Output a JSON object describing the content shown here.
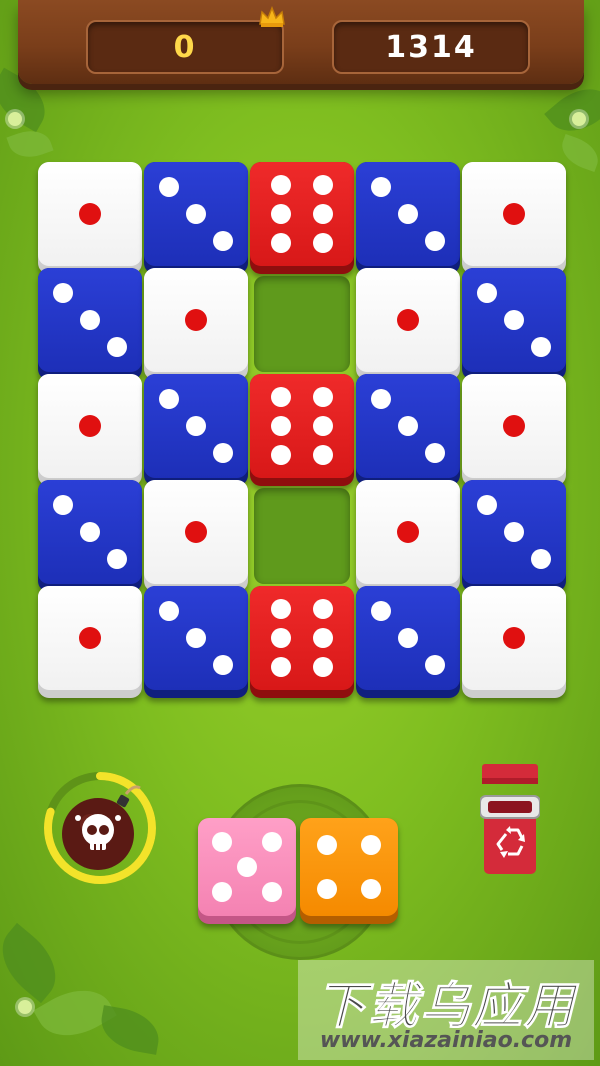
{
  "scores": {
    "current": "0",
    "best": "1314"
  },
  "icons": {
    "crown": "crown-icon",
    "bomb": "bomb-skull-icon",
    "trash": "recycle-trash-icon"
  },
  "colors": {
    "white_die": "#ffffff",
    "blue_die": "#2536cc",
    "red_die": "#e52020",
    "pink_die": "#f78fb9",
    "orange_die": "#f7900a",
    "background": "#86c224"
  },
  "board": {
    "rows": 5,
    "cols": 5,
    "cells": [
      [
        "white-1",
        "blue-3",
        "red-6",
        "blue-3",
        "white-1"
      ],
      [
        "blue-3",
        "white-1",
        "empty",
        "white-1",
        "blue-3"
      ],
      [
        "white-1",
        "blue-3",
        "red-6",
        "blue-3",
        "white-1"
      ],
      [
        "blue-3",
        "white-1",
        "empty",
        "white-1",
        "blue-3"
      ],
      [
        "white-1",
        "blue-3",
        "red-6",
        "blue-3",
        "white-1"
      ]
    ]
  },
  "next_piece": [
    {
      "color": "pink",
      "value": 5
    },
    {
      "color": "orange",
      "value": 4
    }
  ],
  "bomb": {
    "charge": 0.8
  },
  "watermark": {
    "title": "下载乌应用",
    "url": "www.xiazainiao.com"
  }
}
